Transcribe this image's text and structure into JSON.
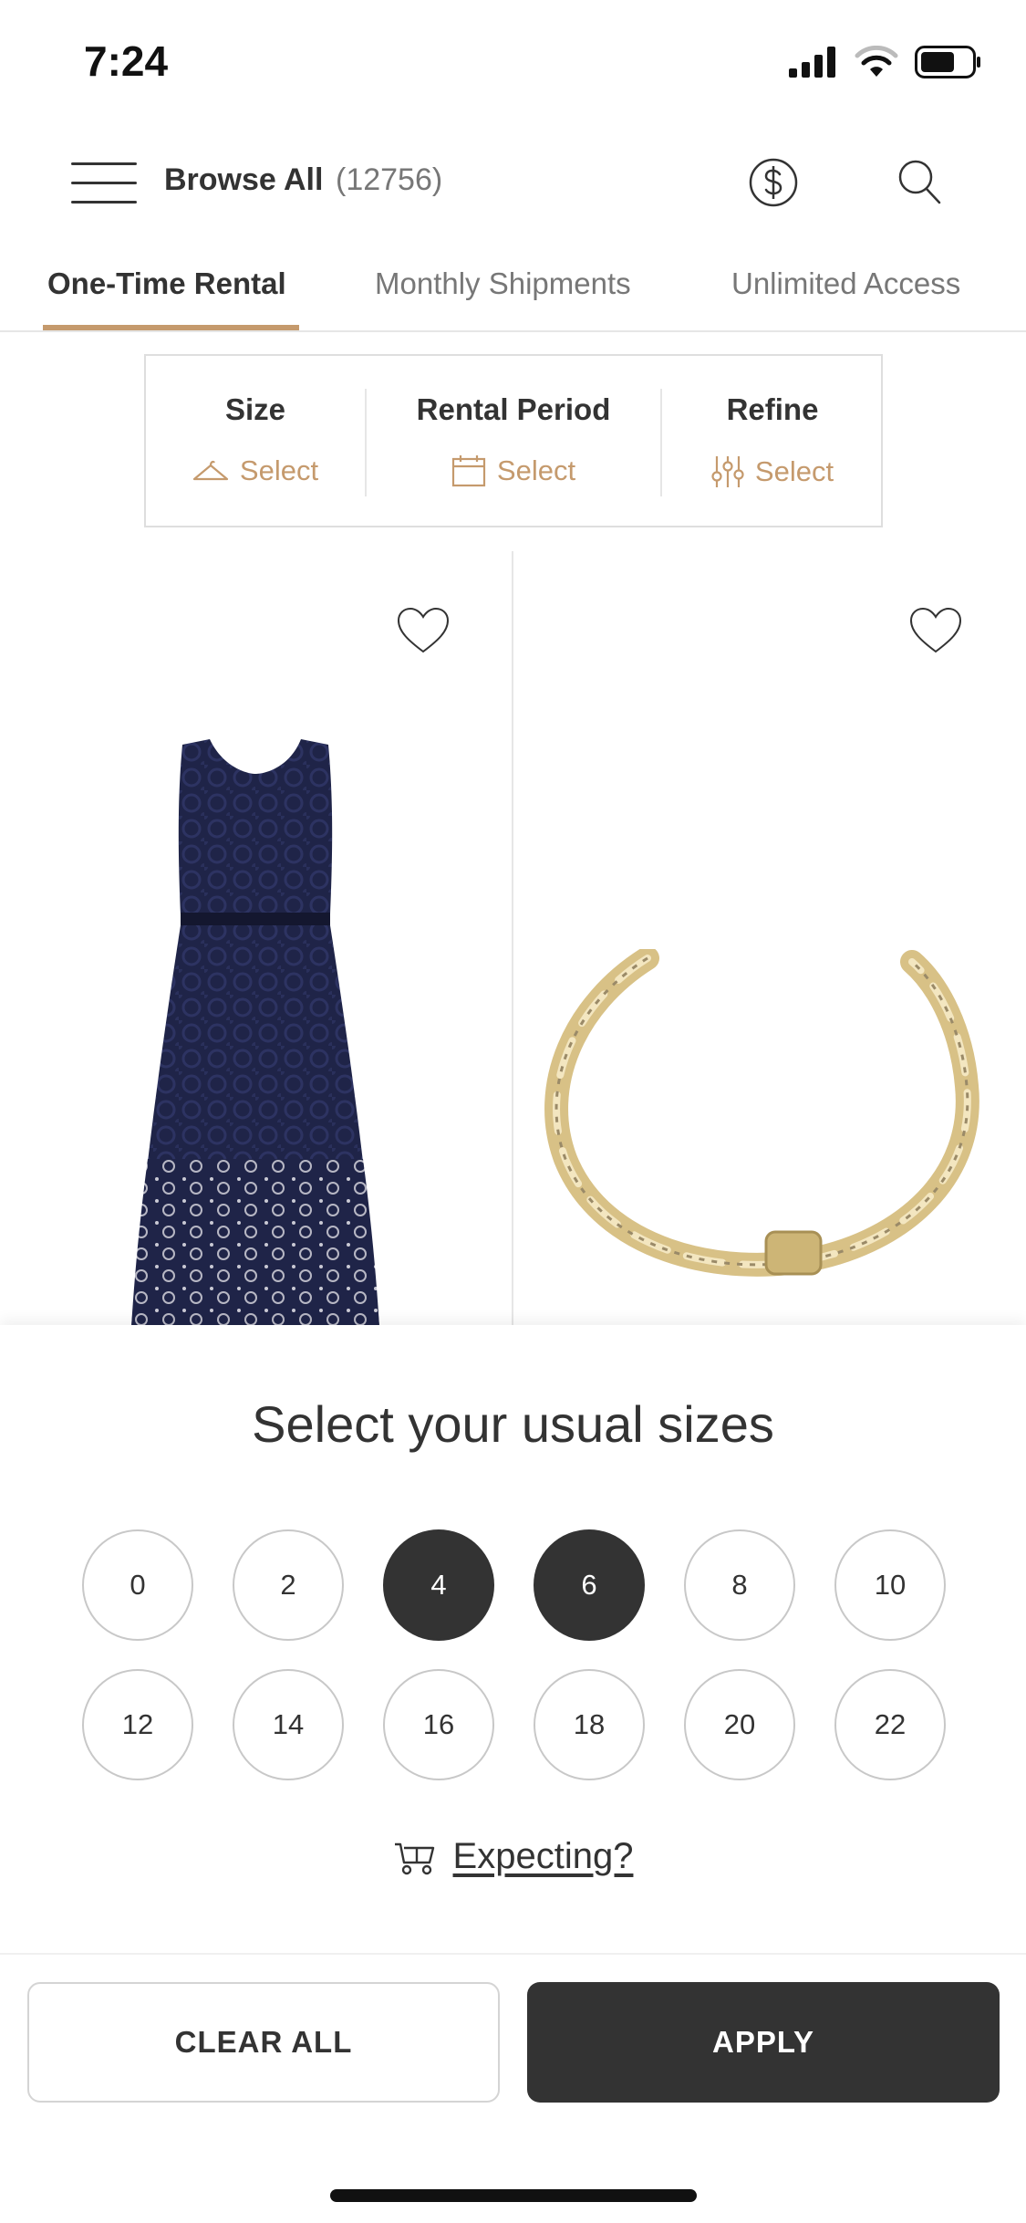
{
  "status_bar": {
    "time": "7:24"
  },
  "header": {
    "title": "Browse All",
    "count": "(12756)"
  },
  "tabs": [
    {
      "label": "One-Time Rental"
    },
    {
      "label": "Monthly Shipments"
    },
    {
      "label": "Unlimited Access"
    }
  ],
  "filters": [
    {
      "label": "Size",
      "value": "Select",
      "icon": "hanger-icon"
    },
    {
      "label": "Rental Period",
      "value": "Select",
      "icon": "calendar-icon"
    },
    {
      "label": "Refine",
      "value": "Select",
      "icon": "sliders-icon"
    }
  ],
  "products": [
    {
      "name": "navy-lace-dress",
      "favorited": false
    },
    {
      "name": "gold-chain-cuff-bracelet",
      "favorited": false
    }
  ],
  "sheet": {
    "title": "Select your usual sizes",
    "sizes": [
      {
        "label": "0",
        "selected": false
      },
      {
        "label": "2",
        "selected": false
      },
      {
        "label": "4",
        "selected": true
      },
      {
        "label": "6",
        "selected": true
      },
      {
        "label": "8",
        "selected": false
      },
      {
        "label": "10",
        "selected": false
      },
      {
        "label": "12",
        "selected": false
      },
      {
        "label": "14",
        "selected": false
      },
      {
        "label": "16",
        "selected": false
      },
      {
        "label": "18",
        "selected": false
      },
      {
        "label": "20",
        "selected": false
      },
      {
        "label": "22",
        "selected": false
      }
    ],
    "expecting_label": "Expecting?"
  },
  "footer": {
    "clear_label": "CLEAR ALL",
    "apply_label": "APPLY"
  },
  "colors": {
    "accent": "#c59a6d",
    "dark": "#333333",
    "border": "#c8c8c8"
  }
}
